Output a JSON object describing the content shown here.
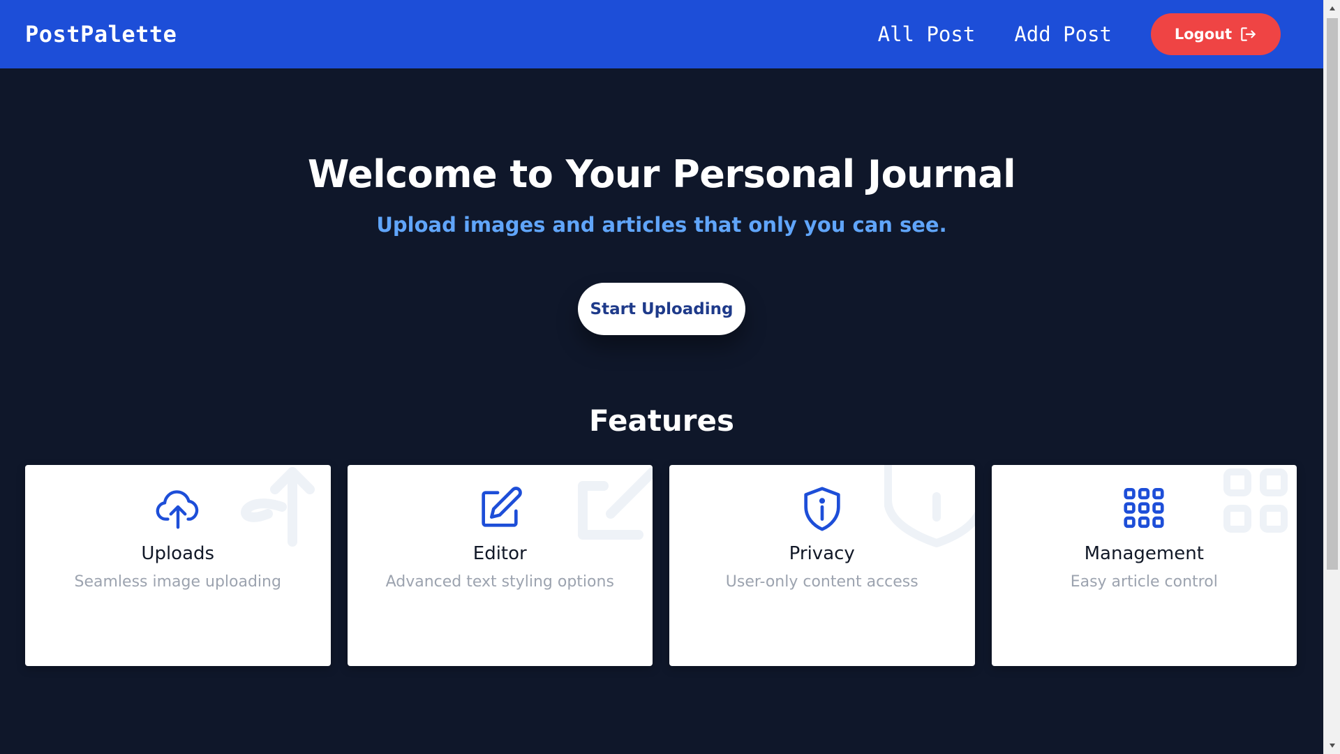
{
  "navbar": {
    "brand": "PostPalette",
    "links": [
      "All Post",
      "Add Post"
    ],
    "logout_label": "Logout"
  },
  "hero": {
    "title": "Welcome to Your Personal Journal",
    "subtitle": "Upload images and articles that only you can see.",
    "cta_label": "Start Uploading"
  },
  "features": {
    "heading": "Features",
    "cards": [
      {
        "title": "Uploads",
        "description": "Seamless image uploading",
        "icon": "cloud-upload-icon"
      },
      {
        "title": "Editor",
        "description": "Advanced text styling options",
        "icon": "edit-icon"
      },
      {
        "title": "Privacy",
        "description": "User-only content access",
        "icon": "shield-info-icon"
      },
      {
        "title": "Management",
        "description": "Easy article control",
        "icon": "grid-icon"
      }
    ]
  },
  "colors": {
    "navbar": "#1d4ed8",
    "background": "#0f172a",
    "logout": "#ef4444",
    "accent_text": "#60a5fa",
    "icon": "#1d4ed8"
  }
}
